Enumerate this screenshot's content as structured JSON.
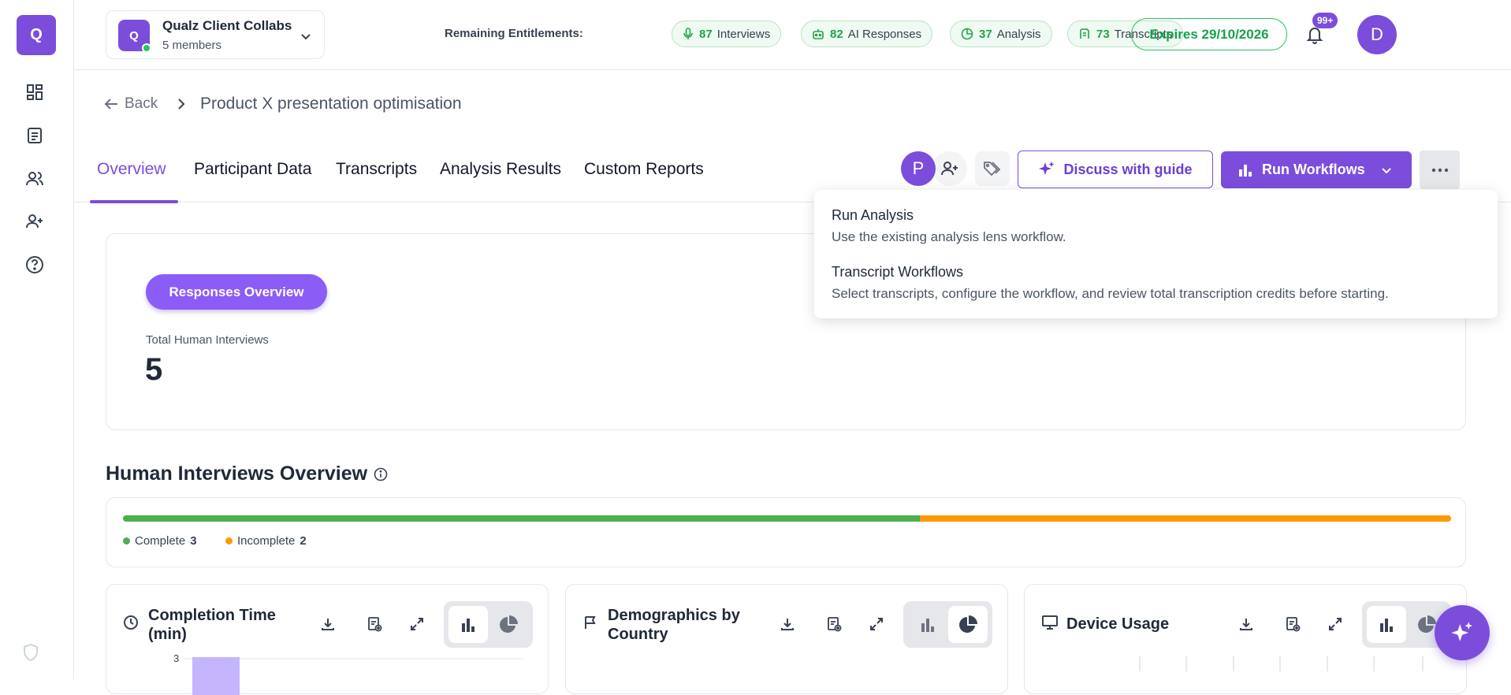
{
  "sidebar": {
    "logo_letter": "Q",
    "icons": [
      "dashboard-icon",
      "document-icon",
      "users-icon",
      "add-user-icon",
      "help-icon"
    ]
  },
  "workspace": {
    "avatar_letter": "Q",
    "name": "Qualz Client Collabs",
    "members": "5 members"
  },
  "entitlements": {
    "label": "Remaining Entitlements:",
    "items": [
      {
        "icon": "microphone-icon",
        "count": "87",
        "label": "Interviews"
      },
      {
        "icon": "robot-icon",
        "count": "82",
        "label": "AI Responses"
      },
      {
        "icon": "pie-icon",
        "count": "37",
        "label": "Analysis"
      },
      {
        "icon": "transcript-icon",
        "count": "73",
        "label": "Transcripts"
      }
    ],
    "expires": "Expires 29/10/2026"
  },
  "notifications": {
    "badge": "99+"
  },
  "user": {
    "avatar_letter": "D"
  },
  "breadcrumb": {
    "back": "Back",
    "title": "Product X presentation optimisation"
  },
  "tabs": [
    {
      "label": "Overview",
      "active": true
    },
    {
      "label": "Participant Data"
    },
    {
      "label": "Transcripts"
    },
    {
      "label": "Analysis Results"
    },
    {
      "label": "Custom Reports"
    }
  ],
  "actions": {
    "participant_avatar": "P",
    "discuss": "Discuss with guide",
    "run_workflows": "Run Workflows"
  },
  "dropdown": {
    "items": [
      {
        "title": "Run Analysis",
        "desc": "Use the existing analysis lens workflow."
      },
      {
        "title": "Transcript Workflows",
        "desc": "Select transcripts, configure the workflow, and review total transcription credits before starting."
      }
    ]
  },
  "responses": {
    "button": "Responses Overview",
    "total_label": "Total Human Interviews",
    "total_value": "5"
  },
  "human_interviews": {
    "title": "Human Interviews Overview",
    "complete_label": "Complete",
    "complete_count": 3,
    "incomplete_label": "Incomplete",
    "incomplete_count": 2,
    "colors": {
      "complete": "#4caf50",
      "incomplete": "#ff9800"
    }
  },
  "charts": [
    {
      "title": "Completion Time (min)",
      "icon": "clock-icon",
      "view": "bar"
    },
    {
      "title": "Demographics by Country",
      "icon": "flag-icon",
      "view": "pie"
    },
    {
      "title": "Device Usage",
      "icon": "monitor-icon",
      "view": "bar"
    }
  ],
  "completion_chart": {
    "tick_label": "3"
  },
  "colors": {
    "accent": "#7c4ddb"
  }
}
